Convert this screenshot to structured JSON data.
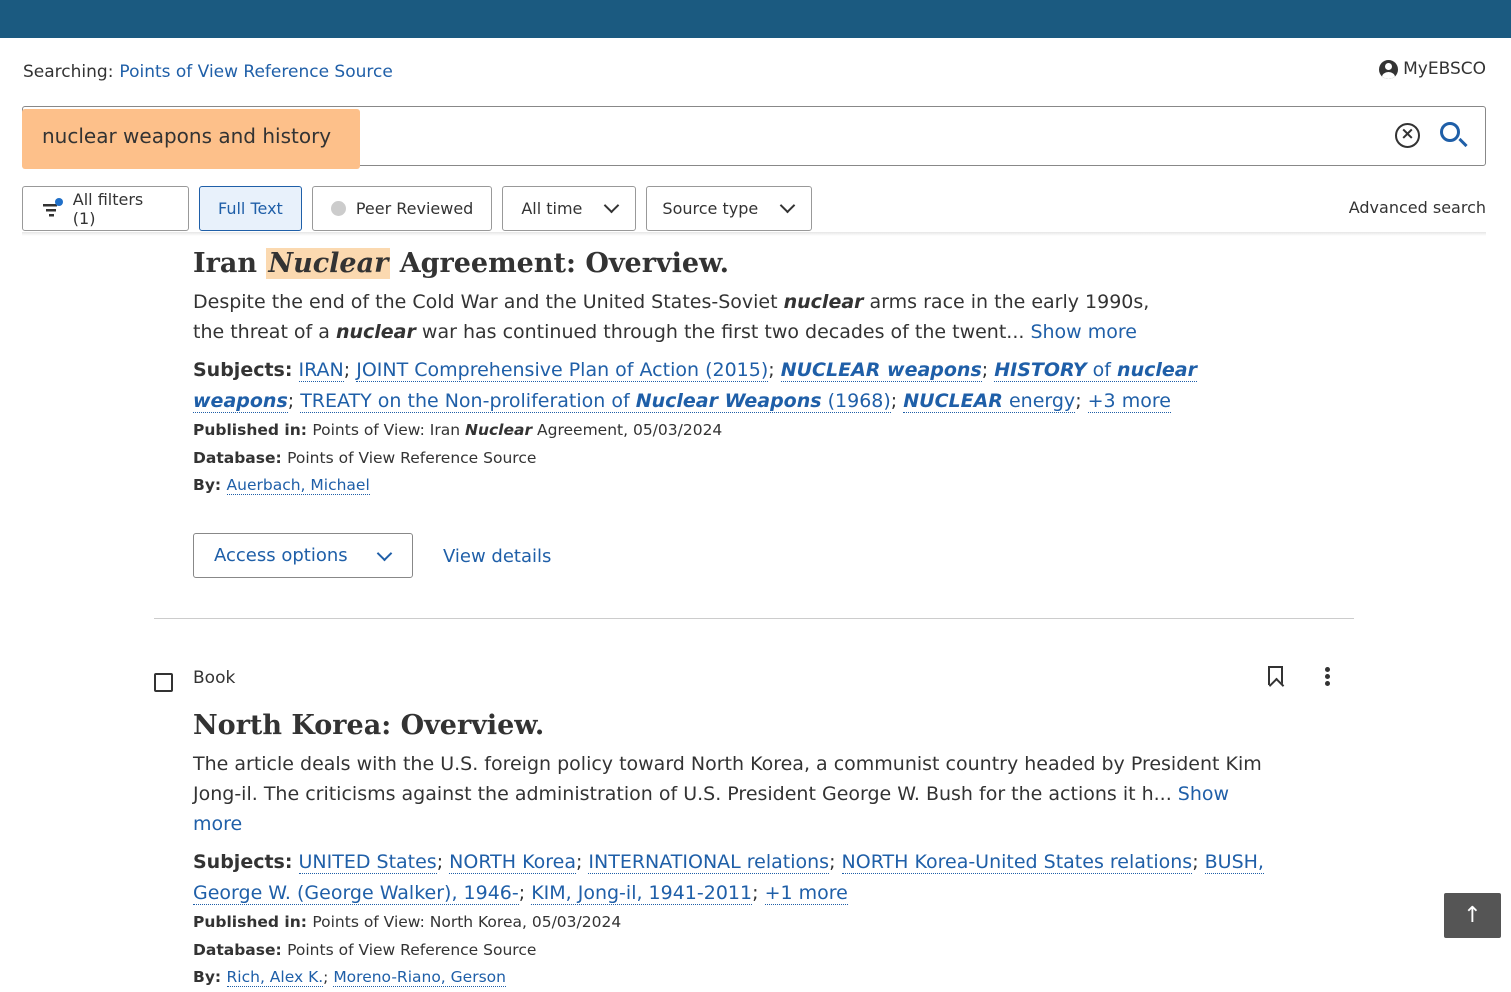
{
  "header": {
    "searching_label": "Searching:",
    "database": "Points of View Reference Source",
    "account": "MyEBSCO"
  },
  "search": {
    "query": "nuclear weapons and history",
    "clear_icon": "close-circle-icon",
    "search_icon": "search-icon"
  },
  "filters": {
    "all_filters": "All filters (1)",
    "full_text": "Full Text",
    "peer_reviewed": "Peer Reviewed",
    "date": "All time",
    "source_type": "Source type",
    "advanced": "Advanced search"
  },
  "results": [
    {
      "title": [
        {
          "t": "Iran "
        },
        {
          "t": "Nuclear",
          "em": true
        },
        {
          "t": " Agreement: Overview."
        }
      ],
      "abstract": [
        {
          "t": "Despite the end of the Cold War and the United States-Soviet "
        },
        {
          "t": "nuclear",
          "em": true
        },
        {
          "t": " arms race in the early 1990s,\nthe threat of a "
        },
        {
          "t": "nuclear",
          "em": true
        },
        {
          "t": " war has continued through the first two decades of the twent... "
        }
      ],
      "show_more": "Show more",
      "subjects_label": "Subjects:",
      "subjects": [
        [
          {
            "t": "IRAN"
          }
        ],
        [
          {
            "t": "JOINT Comprehensive Plan of Action (2015)"
          }
        ],
        [
          {
            "t": "NUCLEAR weapons",
            "em": true
          }
        ],
        [
          {
            "t": "HISTORY",
            "em": true
          },
          {
            "t": " of "
          },
          {
            "t": "nuclear weapons",
            "em": true
          }
        ],
        [
          {
            "t": "TREATY on the Non-proliferation of "
          },
          {
            "t": "Nuclear Weapons",
            "em": true
          },
          {
            "t": " (1968)"
          }
        ],
        [
          {
            "t": "NUCLEAR",
            "em": true
          },
          {
            "t": " energy"
          }
        ]
      ],
      "more_subjects": "+3 more",
      "published_label": "Published in:",
      "published": [
        {
          "t": "Points of View: Iran "
        },
        {
          "t": "Nuclear",
          "em": true
        },
        {
          "t": " Agreement, 05/03/2024"
        }
      ],
      "database_label": "Database:",
      "database": "Points of View Reference Source",
      "by_label": "By:",
      "authors": [
        "Auerbach, Michael"
      ],
      "access_options": "Access options",
      "view_details": "View details"
    },
    {
      "type": "Book",
      "title": [
        {
          "t": "North Korea: Overview."
        }
      ],
      "abstract": [
        {
          "t": "The article deals with the U.S. foreign policy toward North Korea, a communist country headed by President Kim\nJong-il. The criticisms against the administration of U.S. President George W. Bush for the actions it h... "
        }
      ],
      "show_more": "Show more",
      "subjects_label": "Subjects:",
      "subjects": [
        [
          {
            "t": "UNITED States"
          }
        ],
        [
          {
            "t": "NORTH Korea"
          }
        ],
        [
          {
            "t": "INTERNATIONAL relations"
          }
        ],
        [
          {
            "t": "NORTH Korea-United States relations"
          }
        ],
        [
          {
            "t": "BUSH, George W. (George Walker), 1946-"
          }
        ],
        [
          {
            "t": "KIM, Jong-il, 1941-2011"
          }
        ]
      ],
      "more_subjects": "+1 more",
      "published_label": "Published in:",
      "published": [
        {
          "t": "Points of View: North Korea, 05/03/2024"
        }
      ],
      "database_label": "Database:",
      "database": "Points of View Reference Source",
      "by_label": "By:",
      "authors": [
        "Rich, Alex K.",
        "Moreno-Riano, Gerson"
      ]
    }
  ],
  "colors": {
    "topbar": "#1b5a80",
    "link": "#1f5fa8",
    "highlight": "#fdc08a"
  }
}
